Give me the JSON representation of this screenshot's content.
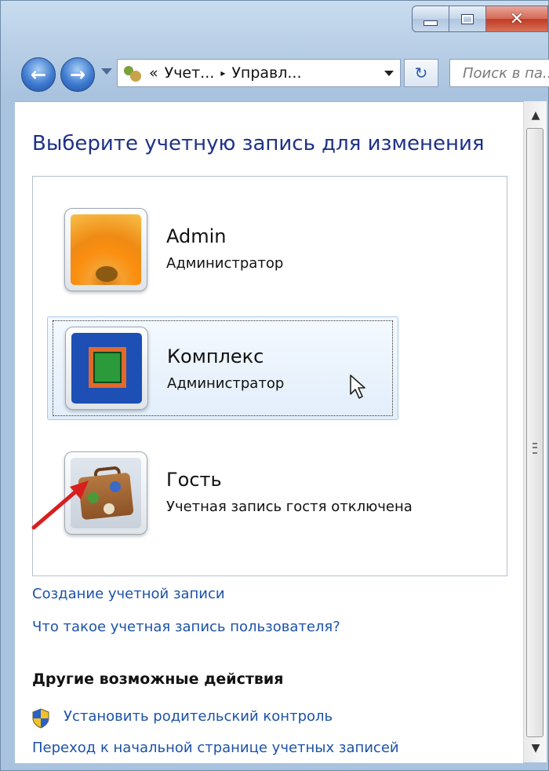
{
  "window": {
    "close_glyph": "✕"
  },
  "navbar": {
    "back_glyph": "←",
    "forward_glyph": "→",
    "address": {
      "chevron_prefix": "«",
      "crumb1": "Учет...",
      "separator": "▸",
      "crumb2": "Управл..."
    },
    "refresh_glyph": "↻",
    "search_placeholder": "Поиск в па..."
  },
  "content": {
    "title": "Выберите учетную запись для изменения",
    "accounts": [
      {
        "name": "Admin",
        "role": "Администратор",
        "avatar": "flower-icon"
      },
      {
        "name": "Комплекс",
        "role": "Администратор",
        "avatar": "window-icon",
        "selected": true
      },
      {
        "name": "Гость",
        "role": "Учетная запись гостя отключена",
        "avatar": "suitcase-icon"
      }
    ],
    "links": {
      "create_account": "Создание учетной записи",
      "what_is_account": "Что такое учетная запись пользователя?"
    },
    "other_actions": {
      "heading": "Другие возможные действия",
      "parental_control": "Установить родительский контроль",
      "go_to_accounts_home": "Переход к начальной странице учетных записей"
    }
  },
  "colors": {
    "title_blue": "#1e3287",
    "link_blue": "#1c52a8",
    "selection_bg": "#e2eefb",
    "arrow_red": "#d81e1e"
  }
}
